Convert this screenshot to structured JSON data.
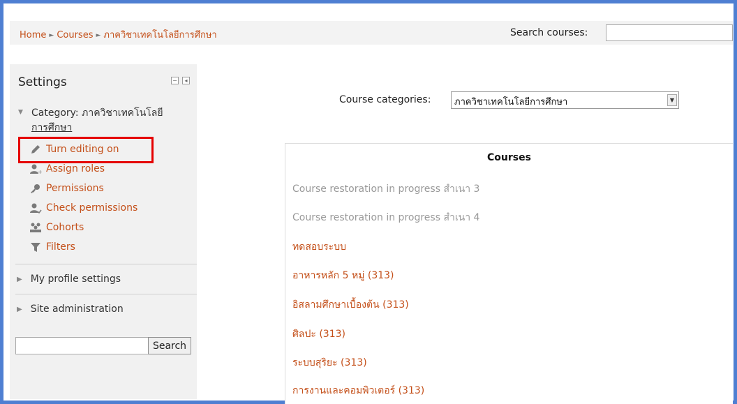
{
  "navbar": {
    "breadcrumb": [
      "Home",
      "Courses",
      "ภาควิชาเทคโนโลยีการศึกษา"
    ],
    "separator": "►",
    "search_label": "Search courses:",
    "search_value": ""
  },
  "settings": {
    "title": "Settings",
    "category_prefix": "Category:",
    "category_name_line1": "ภาควิชาเทคโนโลยี",
    "category_name_line2": "การศึกษา",
    "items": [
      {
        "label": "Turn editing on",
        "icon": "pencil-icon"
      },
      {
        "label": "Assign roles",
        "icon": "user-add-icon"
      },
      {
        "label": "Permissions",
        "icon": "key-icon"
      },
      {
        "label": "Check permissions",
        "icon": "user-check-icon"
      },
      {
        "label": "Cohorts",
        "icon": "group-icon"
      },
      {
        "label": "Filters",
        "icon": "filter-icon"
      }
    ],
    "collapsed": [
      "My profile settings",
      "Site administration"
    ],
    "search_button": "Search"
  },
  "main": {
    "categories_label": "Course categories:",
    "categories_selected": "ภาควิชาเทคโนโลยีการศึกษา",
    "courses_header": "Courses",
    "courses": [
      {
        "name": "Course restoration in progress สำเนา 3",
        "dimmed": true
      },
      {
        "name": "Course restoration in progress สำเนา 4",
        "dimmed": true
      },
      {
        "name": "ทดสอบระบบ",
        "dimmed": false
      },
      {
        "name": "อาหารหลัก 5 หมู่ (313)",
        "dimmed": false
      },
      {
        "name": "อิสลามศึกษาเบื้องต้น (313)",
        "dimmed": false
      },
      {
        "name": "ศิลปะ (313)",
        "dimmed": false
      },
      {
        "name": "ระบบสุริยะ (313)",
        "dimmed": false
      },
      {
        "name": "การงานและคอมพิวเตอร์ (313)",
        "dimmed": false
      }
    ]
  },
  "colors": {
    "link": "#c4501a",
    "frame": "#4f7fd2",
    "highlight": "#e50000"
  }
}
